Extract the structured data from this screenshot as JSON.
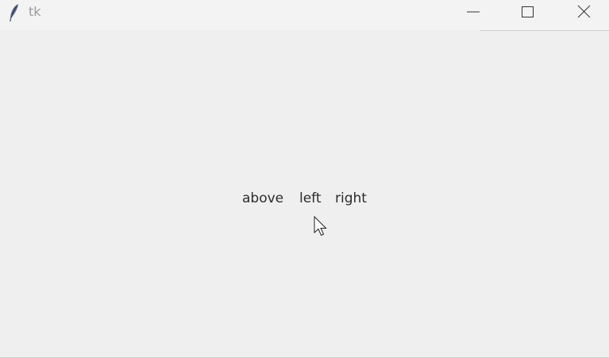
{
  "window": {
    "title": "tk",
    "icon": "feather-icon",
    "controls": {
      "minimize": "minimize-icon",
      "maximize": "maximize-icon",
      "close": "close-icon"
    }
  },
  "content": {
    "labels": [
      "above",
      "left",
      "right"
    ]
  },
  "colors": {
    "background": "#efefef",
    "titlebar": "#f3f3f3",
    "text": "#2b2b2b",
    "title_text": "#9a9a9a"
  }
}
